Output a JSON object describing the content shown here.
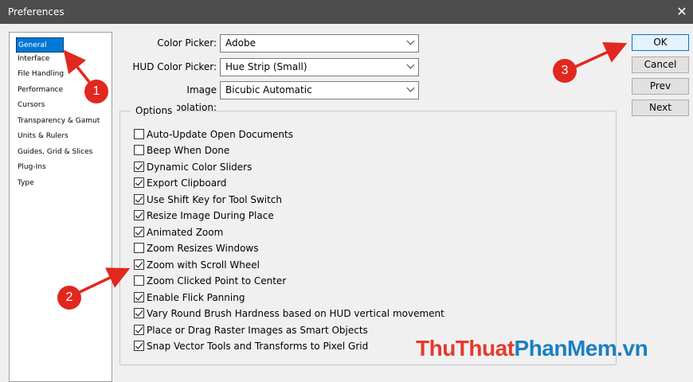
{
  "window": {
    "title": "Preferences",
    "close_glyph": "✕"
  },
  "sidebar": {
    "items": [
      {
        "label": "General",
        "selected": true
      },
      {
        "label": "Interface"
      },
      {
        "label": "File Handling"
      },
      {
        "label": "Performance"
      },
      {
        "label": "Cursors"
      },
      {
        "label": "Transparency & Gamut"
      },
      {
        "label": "Units & Rulers"
      },
      {
        "label": "Guides, Grid & Slices"
      },
      {
        "label": "Plug-Ins"
      },
      {
        "label": "Type"
      }
    ]
  },
  "pickers": {
    "color_picker": {
      "label": "Color Picker:",
      "value": "Adobe"
    },
    "hud_color_picker": {
      "label": "HUD Color Picker:",
      "value": "Hue Strip (Small)"
    },
    "image_interpolation": {
      "label": "Image Interpolation:",
      "value": "Bicubic Automatic"
    }
  },
  "options": {
    "title": "Options",
    "items": [
      {
        "label": "Auto-Update Open Documents",
        "checked": false
      },
      {
        "label": "Beep When Done",
        "checked": false
      },
      {
        "label": "Dynamic Color Sliders",
        "checked": true
      },
      {
        "label": "Export Clipboard",
        "checked": true
      },
      {
        "label": "Use Shift Key for Tool Switch",
        "checked": true
      },
      {
        "label": "Resize Image During Place",
        "checked": true
      },
      {
        "label": "Animated Zoom",
        "checked": true
      },
      {
        "label": "Zoom Resizes Windows",
        "checked": false
      },
      {
        "label": "Zoom with Scroll Wheel",
        "checked": true
      },
      {
        "label": "Zoom Clicked Point to Center",
        "checked": false
      },
      {
        "label": "Enable Flick Panning",
        "checked": true
      },
      {
        "label": "Vary Round Brush Hardness based on HUD vertical movement",
        "checked": true
      },
      {
        "label": "Place or Drag Raster Images as Smart Objects",
        "checked": true
      },
      {
        "label": "Snap Vector Tools and Transforms to Pixel Grid",
        "checked": true
      }
    ]
  },
  "buttons": {
    "ok": "OK",
    "cancel": "Cancel",
    "prev": "Prev",
    "next": "Next"
  },
  "annotations": {
    "marker1": "1",
    "marker2": "2",
    "marker3": "3",
    "accent": "#e0281e"
  },
  "watermark": {
    "part1": "ThuThuat",
    "part2": "PhanMem",
    "part3": ".vn"
  }
}
